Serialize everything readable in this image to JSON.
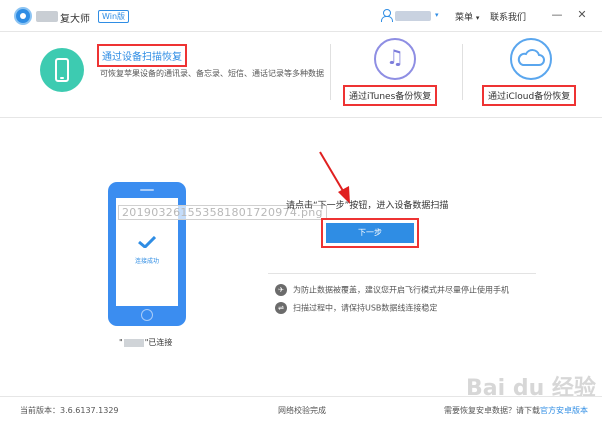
{
  "titlebar": {
    "app_title": "复大师",
    "edition_badge": "Win版",
    "menu_label": "菜单",
    "menu_caret": "▾",
    "contact_label": "联系我们",
    "user_caret": "▾",
    "minimize_glyph": "—",
    "close_glyph": "✕"
  },
  "options": {
    "device_scan_title": "通过设备扫描恢复",
    "device_scan_desc": "可恢复苹果设备的通讯录、备忘录、短信、通话记录等多种数据",
    "itunes_label": "通过iTunes备份恢复",
    "icloud_label": "通过iCloud备份恢复",
    "music_glyph": "♫"
  },
  "main": {
    "watermark_text": "20190326155358180172097​4.png",
    "connected_text": "连接成功",
    "device_suffix": "\"已连接",
    "device_prefix": "\"",
    "instruction": "请点击“下一步”按钮，进入设备数据扫描",
    "next_button": "下一步",
    "tips": [
      {
        "glyph": "✈",
        "text": "为防止数据被覆盖，建议您开启飞行模式并尽量停止使用手机"
      },
      {
        "glyph": "⇌",
        "text": "扫描过程中，请保持USB数据线连接稳定"
      }
    ]
  },
  "footer": {
    "version": "当前版本：3.6.6137.1329",
    "network": "网络校验完成",
    "android_hint": "需要恢复安卓数据？请下载",
    "android_link": "官方安卓版本"
  },
  "watermark_brand": "Bai du 经验",
  "colors": {
    "accent": "#2f8de4",
    "teal": "#3dcbb1",
    "highlight_red": "#e33"
  }
}
